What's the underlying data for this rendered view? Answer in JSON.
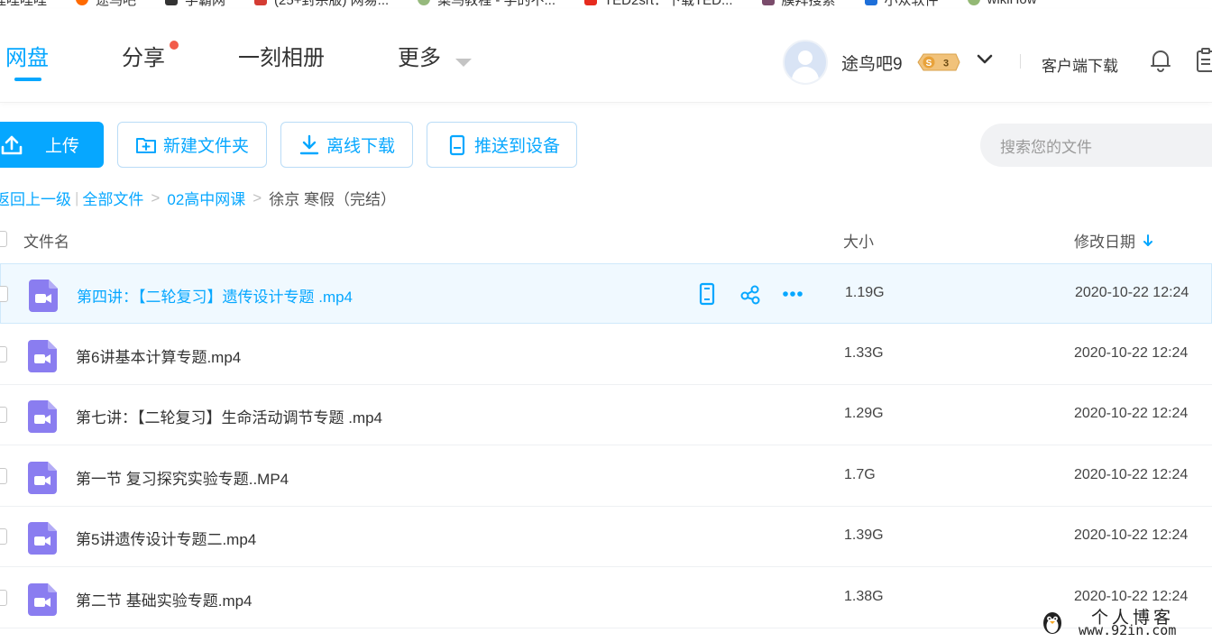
{
  "bookmarks": [
    {
      "label": "哩哩哩哩",
      "icon": "bilibili-icon",
      "color": "#fb7299"
    },
    {
      "label": "途鸟吧",
      "icon": "tuniao-icon",
      "color": "#ff6a00"
    },
    {
      "label": "学霸网",
      "icon": "xueba-icon",
      "color": "#333333"
    },
    {
      "label": "(25+封杀版) 网易...",
      "icon": "netease-icon",
      "color": "#d43c33"
    },
    {
      "label": "菜鸟教程 - 学的不...",
      "icon": "runoob-icon",
      "color": "#96b97d"
    },
    {
      "label": "TED2srt：下载TED...",
      "icon": "ted-icon",
      "color": "#e62b1e"
    },
    {
      "label": "膜拜搜索",
      "icon": "mobai-icon",
      "color": "#7a4b6b"
    },
    {
      "label": "小众软件",
      "icon": "appinn-icon",
      "color": "#1e6fd9"
    },
    {
      "label": "wikiHow",
      "icon": "wikihow-icon",
      "color": "#93b874"
    }
  ],
  "nav": {
    "tabs": [
      {
        "label": "网盘",
        "active": true
      },
      {
        "label": "分享",
        "has_dot": true
      },
      {
        "label": "一刻相册"
      },
      {
        "label": "更多"
      }
    ],
    "username": "途鸟吧9",
    "vip_level": "3",
    "vip_prefix": "S",
    "client_download": "客户端下载"
  },
  "toolbar": {
    "upload": "上传",
    "new_folder": "新建文件夹",
    "offline_download": "离线下载",
    "push_device": "推送到设备",
    "search_placeholder": "搜索您的文件"
  },
  "breadcrumb": {
    "back": "返回上一级",
    "all_files": "全部文件",
    "parent": "02高中网课",
    "current": "徐京 寒假（完结）"
  },
  "table": {
    "headers": {
      "name": "文件名",
      "size": "大小",
      "date": "修改日期"
    },
    "rows": [
      {
        "name": "第四讲：【二轮复习】遗传设计专题 .mp4",
        "size": "1.19G",
        "date": "2020-10-22 12:24",
        "hover": true
      },
      {
        "name": "第6讲基本计算专题.mp4",
        "size": "1.33G",
        "date": "2020-10-22 12:24"
      },
      {
        "name": "第七讲：【二轮复习】生命活动调节专题 .mp4",
        "size": "1.29G",
        "date": "2020-10-22 12:24"
      },
      {
        "name": "第一节 复习探究实验专题..MP4",
        "size": "1.7G",
        "date": "2020-10-22 12:24"
      },
      {
        "name": "第5讲遗传设计专题二.mp4",
        "size": "1.39G",
        "date": "2020-10-22 12:24"
      },
      {
        "name": "第二节 基础实验专题.mp4",
        "size": "1.38G",
        "date": "2020-10-22 12:24"
      }
    ]
  },
  "watermark": {
    "line1": "个人博客",
    "line2": "www.92in.com"
  },
  "colors": {
    "accent": "#06a7ff",
    "video_icon": "#8a7df0",
    "dot": "#f25c4a",
    "hover_bg": "#f0f9ff"
  }
}
